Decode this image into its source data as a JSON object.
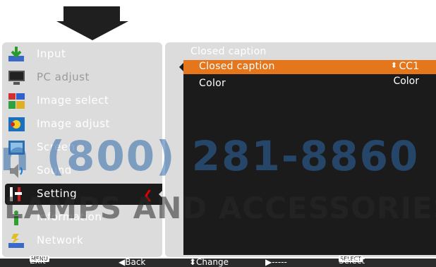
{
  "menu": {
    "items": [
      {
        "label": "Input",
        "icon": "input-icon"
      },
      {
        "label": "PC adjust",
        "icon": "pc-adjust-icon"
      },
      {
        "label": "Image select",
        "icon": "image-select-icon"
      },
      {
        "label": "Image adjust",
        "icon": "image-adjust-icon"
      },
      {
        "label": "Screen",
        "icon": "screen-icon"
      },
      {
        "label": "Sound",
        "icon": "sound-icon"
      },
      {
        "label": "Setting",
        "icon": "setting-icon",
        "selected": true
      },
      {
        "label": "Information",
        "icon": "information-icon"
      },
      {
        "label": "Network",
        "icon": "network-icon"
      }
    ]
  },
  "panel": {
    "title": "Closed caption",
    "rows": [
      {
        "label": "Closed caption",
        "value": "CC1",
        "highlighted": true
      },
      {
        "label": "Color",
        "value": "Color"
      }
    ]
  },
  "footer": {
    "exit_key": "MENU",
    "exit": "Exit",
    "back": "◀Back",
    "change": "⬍Change",
    "next": "▶-----",
    "select_key": "SELECT",
    "select": "Select"
  },
  "watermark": {
    "phone": "n (800) 281-8860",
    "text": "LAMPS AND ACCESSORIES"
  },
  "colors": {
    "menu_bg": "#dcdcdc",
    "selected_bg": "#1b1b1b",
    "highlight": "#e6761b",
    "cursor": "#e00000"
  }
}
